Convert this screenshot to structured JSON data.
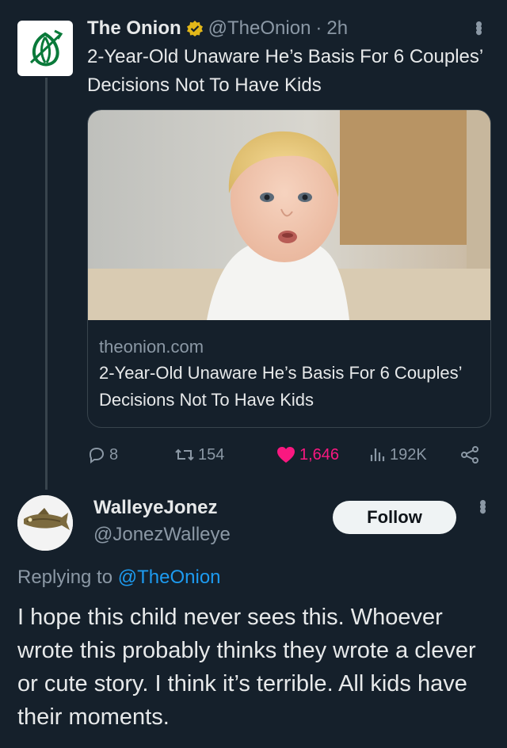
{
  "tweet": {
    "author_name": "The Onion",
    "handle": "@TheOnion",
    "separator": "·",
    "time": "2h",
    "text": "2-Year-Old Unaware He’s Basis For 6 Couples’ Decisions Not To Have Kids",
    "card": {
      "domain": "theonion.com",
      "title": "2-Year-Old Unaware He’s Basis For 6 Couples’ Decisions Not To Have Kids"
    },
    "stats": {
      "replies": "8",
      "retweets": "154",
      "likes": "1,646",
      "views": "192K"
    }
  },
  "reply": {
    "author_name": "WalleyeJonez",
    "handle": "@JonezWalleye",
    "follow_label": "Follow",
    "replying_prefix": "Replying to",
    "replying_to": "@TheOnion",
    "text": "I hope this child never sees this. Whoever wrote this probably thinks they wrote a clever or cute story. I think it’s terrible. All kids have their moments."
  },
  "colors": {
    "background": "#15202b",
    "accent": "#1d9bf0",
    "like": "#f91880",
    "verified": "#e2b719",
    "onion_logo": "#0a7a3a"
  }
}
